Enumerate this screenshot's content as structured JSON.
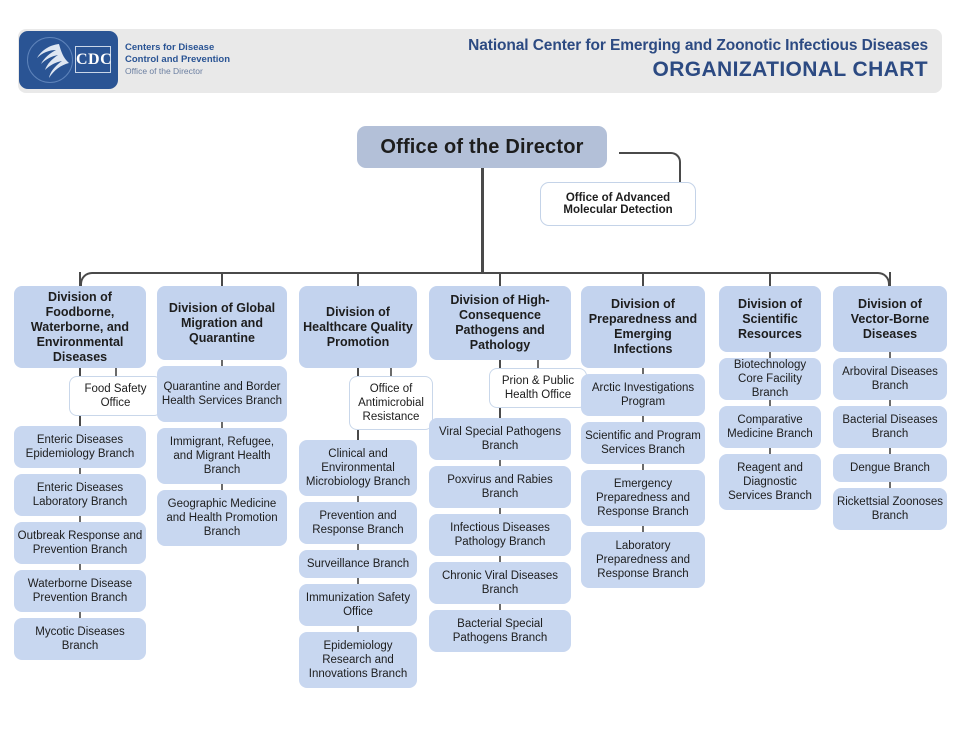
{
  "header": {
    "logo_name": "cdc-logo",
    "agency_line1": "Centers for Disease",
    "agency_line2": "Control and Prevention",
    "agency_line3": "Office of the Director",
    "logo_text": "CDC",
    "title_line1": "National Center for Emerging and Zoonotic Infectious Diseases",
    "title_line2": "ORGANIZATIONAL CHART",
    "title_color": "#2c4a82",
    "bar_color": "#e9e9e9",
    "logo_color": "#2a5494"
  },
  "chart": {
    "root": {
      "label": "Office of the Director"
    },
    "root_office": {
      "label": "Office of Advanced Molecular Detection"
    },
    "colors": {
      "director": "#b3c0d8",
      "division": "#c3d3ee",
      "branch": "#c8d7f0",
      "office": "#ffffff",
      "connector": "#4a4a4a"
    },
    "divisions": [
      {
        "title": "Division of Foodborne, Waterborne, and Environmental Diseases",
        "office": "Food Safety Office",
        "branches": [
          "Enteric Diseases Epidemiology Branch",
          "Enteric Diseases Laboratory Branch",
          "Outbreak Response and Prevention Branch",
          "Waterborne Disease Prevention Branch",
          "Mycotic Diseases Branch"
        ]
      },
      {
        "title": "Division of Global Migration and Quarantine",
        "office": null,
        "branches": [
          "Quarantine and Border Health Services Branch",
          "Immigrant, Refugee, and Migrant Health Branch",
          "Geographic Medicine and Health Promotion Branch"
        ]
      },
      {
        "title": "Division of Healthcare Quality Promotion",
        "office": "Office of Antimicrobial Resistance",
        "branches": [
          "Clinical and Environmental Microbiology Branch",
          "Prevention and Response Branch",
          "Surveillance Branch",
          "Immunization Safety Office",
          "Epidemiology Research and Innovations Branch"
        ]
      },
      {
        "title": "Division of High-Consequence Pathogens and Pathology",
        "office": "Prion & Public Health Office",
        "branches": [
          "Viral Special Pathogens Branch",
          "Poxvirus and Rabies Branch",
          "Infectious Diseases Pathology Branch",
          "Chronic Viral Diseases Branch",
          "Bacterial Special Pathogens Branch"
        ]
      },
      {
        "title": "Division of Preparedness and Emerging Infections",
        "office": null,
        "branches": [
          "Arctic Investigations Program",
          "Scientific and Program Services Branch",
          "Emergency Preparedness and Response Branch",
          "Laboratory Preparedness and Response Branch"
        ]
      },
      {
        "title": "Division of Scientific Resources",
        "office": null,
        "branches": [
          "Biotechnology Core Facility Branch",
          "Comparative Medicine Branch",
          "Reagent and Diagnostic Services Branch"
        ]
      },
      {
        "title": "Division of Vector-Borne Diseases",
        "office": null,
        "branches": [
          "Arboviral Diseases Branch",
          "Bacterial Diseases Branch",
          "Dengue Branch",
          "Rickettsial Zoonoses Branch"
        ]
      }
    ]
  }
}
